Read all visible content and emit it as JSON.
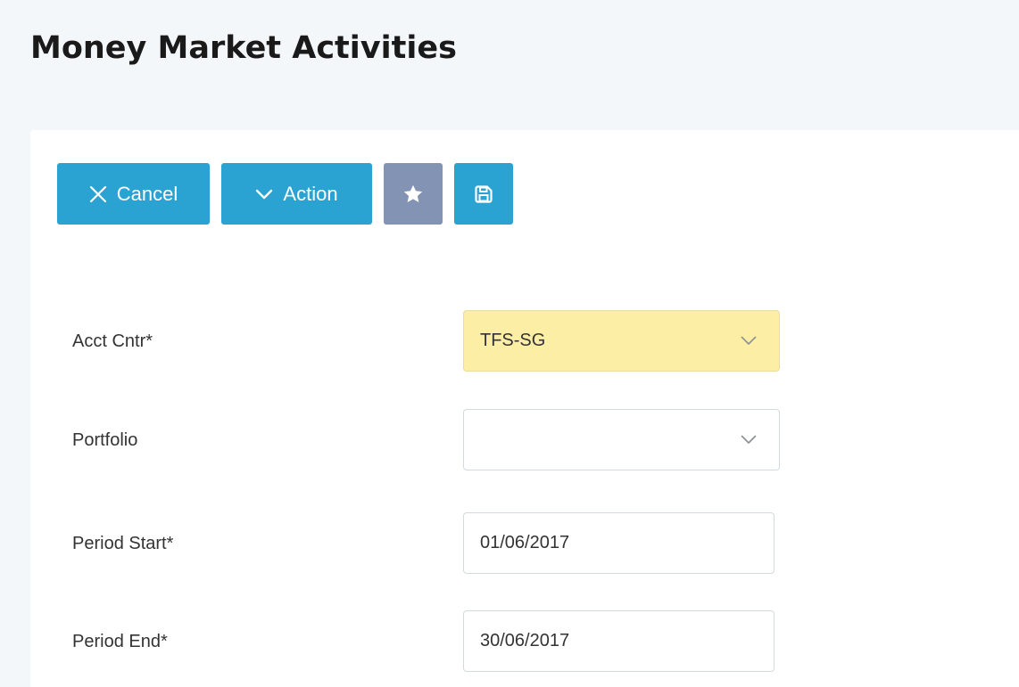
{
  "page": {
    "title": "Money Market Activities"
  },
  "toolbar": {
    "cancel_label": "Cancel",
    "action_label": "Action",
    "cancel_icon": "close-icon",
    "action_icon": "chevron-down-icon",
    "favorite_icon": "star-icon",
    "save_icon": "floppy-disk-icon"
  },
  "form": {
    "acct_cntr": {
      "label": "Acct Cntr*",
      "value": "TFS-SG"
    },
    "portfolio": {
      "label": "Portfolio",
      "value": ""
    },
    "period_start": {
      "label": "Period Start*",
      "value": "01/06/2017"
    },
    "period_end": {
      "label": "Period End*",
      "value": "30/06/2017"
    }
  },
  "colors": {
    "primary_button": "#2aa3d3",
    "secondary_button": "#8293b4",
    "required_field": "#fdeea5",
    "page_background": "#f4f7fa"
  }
}
